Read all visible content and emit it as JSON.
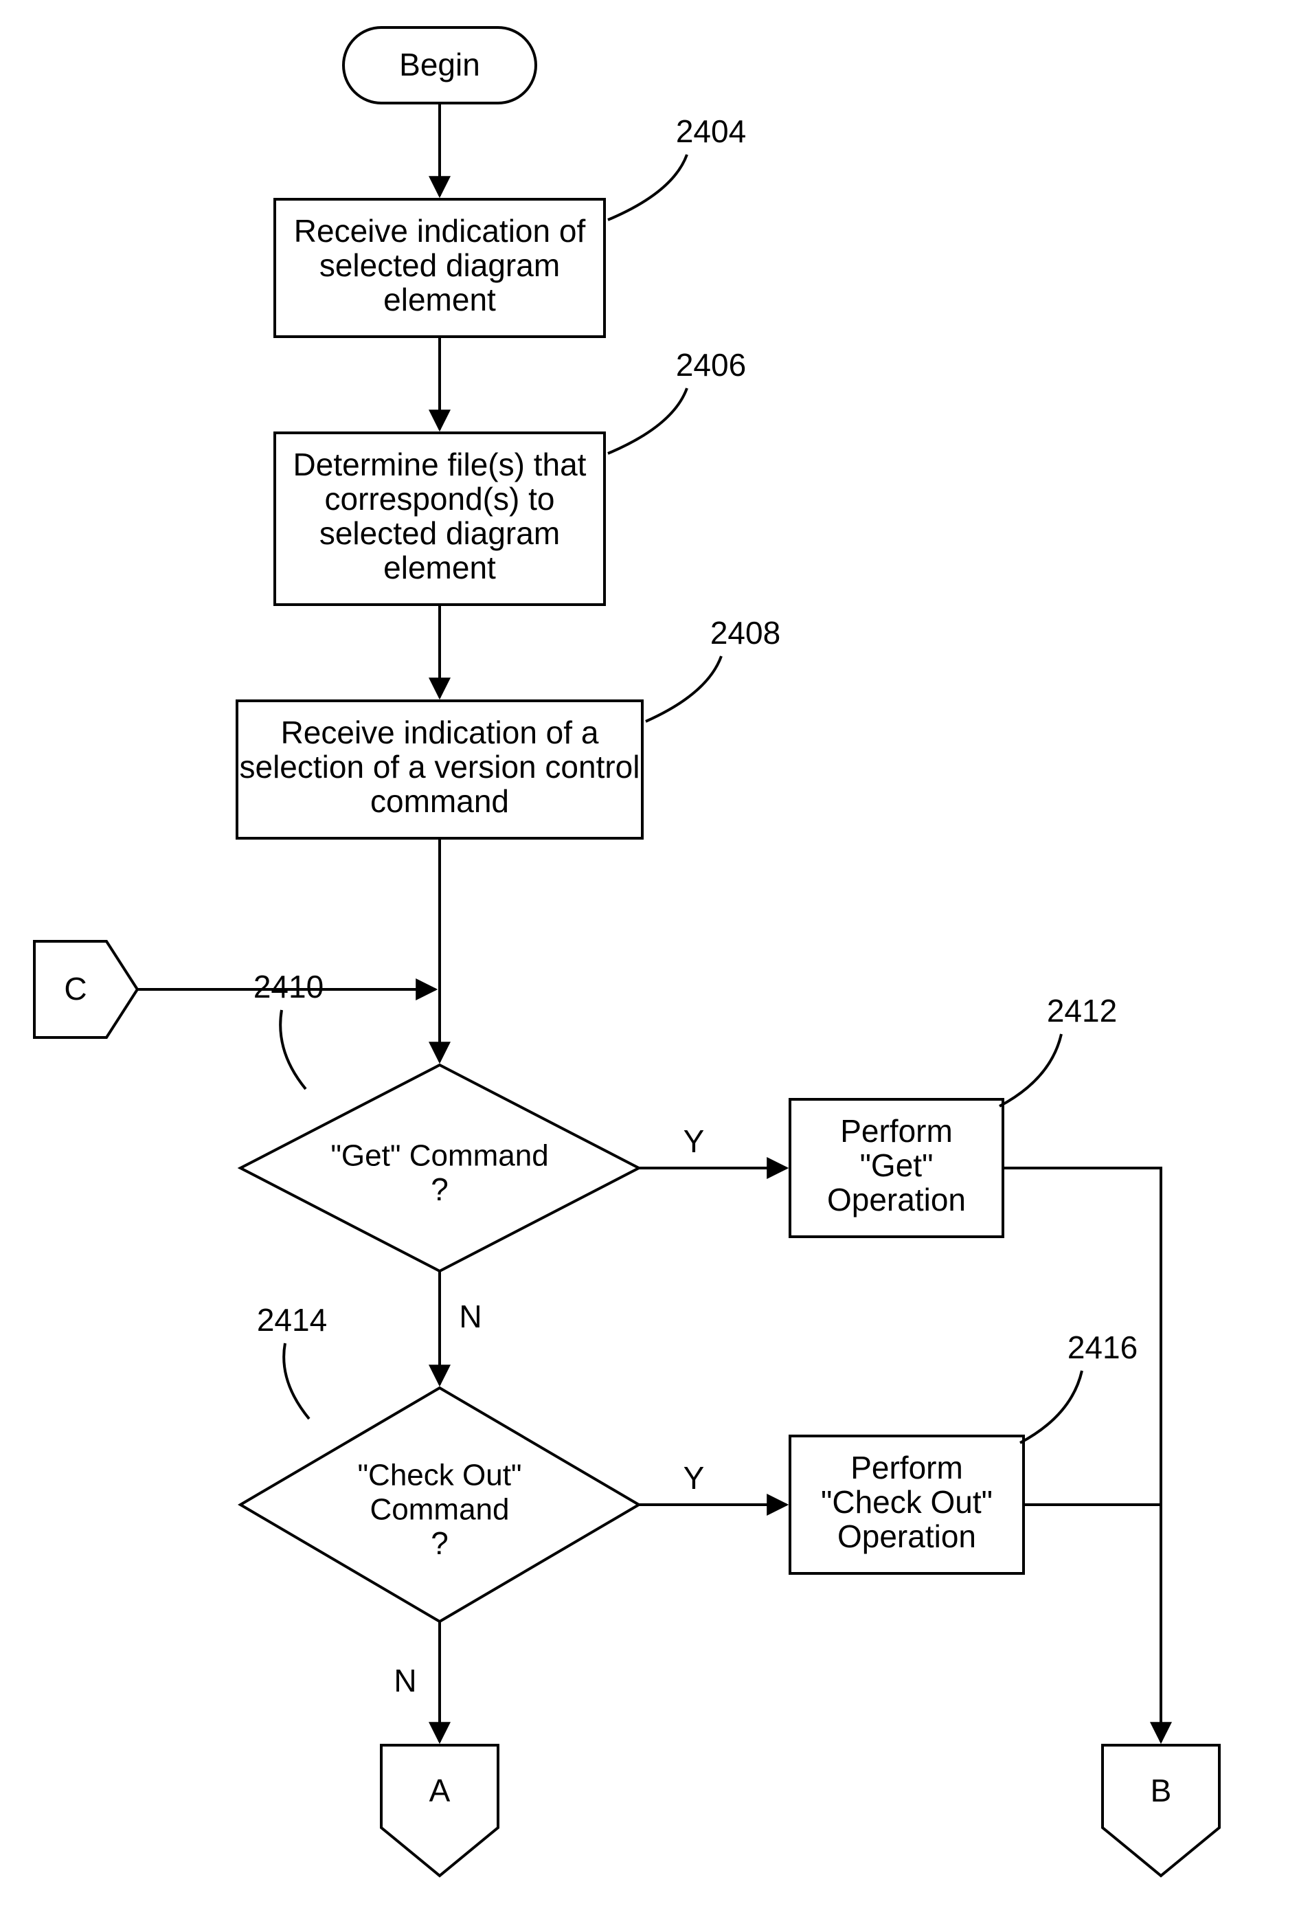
{
  "chart_data": {
    "type": "flowchart",
    "nodes": [
      {
        "id": "begin",
        "kind": "terminator",
        "label": "Begin"
      },
      {
        "id": "step2404",
        "kind": "process",
        "ref": "2404",
        "lines": [
          "Receive indication of",
          "selected diagram",
          "element"
        ]
      },
      {
        "id": "step2406",
        "kind": "process",
        "ref": "2406",
        "lines": [
          "Determine file(s) that",
          "correspond(s) to",
          "selected diagram",
          "element"
        ]
      },
      {
        "id": "step2408",
        "kind": "process",
        "ref": "2408",
        "lines": [
          "Receive indication of a",
          "selection of a version control",
          "command"
        ]
      },
      {
        "id": "connC",
        "kind": "offpage-connector",
        "label": "C"
      },
      {
        "id": "dec2410",
        "kind": "decision",
        "ref": "2410",
        "lines": [
          "\"Get\" Command",
          "?"
        ]
      },
      {
        "id": "step2412",
        "kind": "process",
        "ref": "2412",
        "lines": [
          "Perform",
          "\"Get\"",
          "Operation"
        ]
      },
      {
        "id": "dec2414",
        "kind": "decision",
        "ref": "2414",
        "lines": [
          "\"Check Out\"",
          "Command",
          "?"
        ]
      },
      {
        "id": "step2416",
        "kind": "process",
        "ref": "2416",
        "lines": [
          "Perform",
          "\"Check Out\"",
          "Operation"
        ]
      },
      {
        "id": "connA",
        "kind": "offpage-connector",
        "label": "A"
      },
      {
        "id": "connB",
        "kind": "offpage-connector",
        "label": "B"
      }
    ],
    "edges": [
      {
        "from": "begin",
        "to": "step2404"
      },
      {
        "from": "step2404",
        "to": "step2406"
      },
      {
        "from": "step2406",
        "to": "step2408"
      },
      {
        "from": "step2408",
        "to": "dec2410"
      },
      {
        "from": "connC",
        "to": "dec2410"
      },
      {
        "from": "dec2410",
        "to": "step2412",
        "label": "Y"
      },
      {
        "from": "dec2410",
        "to": "dec2414",
        "label": "N"
      },
      {
        "from": "dec2414",
        "to": "step2416",
        "label": "Y"
      },
      {
        "from": "dec2414",
        "to": "connA",
        "label": "N"
      },
      {
        "from": "step2412",
        "to": "connB"
      },
      {
        "from": "step2416",
        "to": "connB"
      }
    ]
  },
  "begin": "Begin",
  "n2404": {
    "l1": "Receive indication of",
    "l2": "selected diagram",
    "l3": "element",
    "ref": "2404"
  },
  "n2406": {
    "l1": "Determine file(s) that",
    "l2": "correspond(s) to",
    "l3": "selected diagram",
    "l4": "element",
    "ref": "2406"
  },
  "n2408": {
    "l1": "Receive indication of a",
    "l2": "selection of a version control",
    "l3": "command",
    "ref": "2408"
  },
  "d2410": {
    "l1": "\"Get\" Command",
    "l2": "?",
    "ref": "2410"
  },
  "p2412": {
    "l1": "Perform",
    "l2": "\"Get\"",
    "l3": "Operation",
    "ref": "2412"
  },
  "d2414": {
    "l1": "\"Check Out\"",
    "l2": "Command",
    "l3": "?",
    "ref": "2414"
  },
  "p2416": {
    "l1": "Perform",
    "l2": "\"Check Out\"",
    "l3": "Operation",
    "ref": "2416"
  },
  "connA": "A",
  "connB": "B",
  "connC": "C",
  "yes": "Y",
  "no": "N"
}
